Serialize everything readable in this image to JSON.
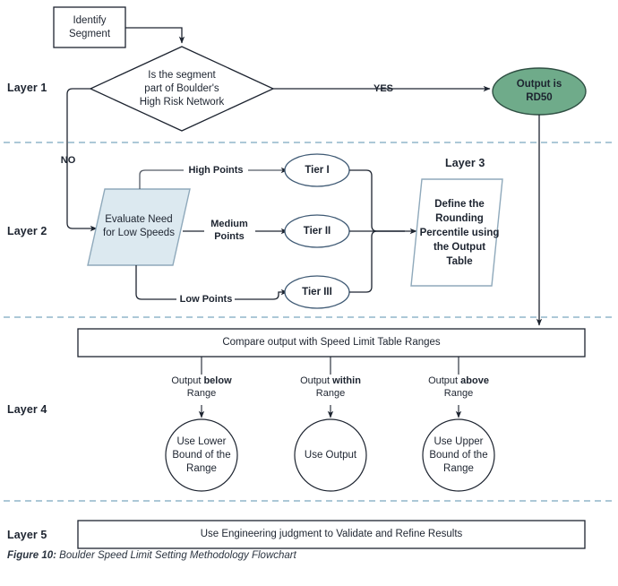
{
  "figure": {
    "caption_lead": "Figure 10:",
    "caption_text": " Boulder Speed Limit Setting Methodology Flowchart"
  },
  "colors": {
    "green_fill": "#6fab8a",
    "green_stroke": "#2f4f43",
    "blue_fill": "#dce9f0",
    "blue_stroke": "#8fa9bb",
    "line": "#1d2430",
    "divider": "#7ba7bf",
    "text": "#1d2430"
  },
  "layers": [
    {
      "id": "layer-1",
      "label": "Layer 1"
    },
    {
      "id": "layer-2",
      "label": "Layer 2"
    },
    {
      "id": "layer-3",
      "label": "Layer 3"
    },
    {
      "id": "layer-4",
      "label": "Layer 4"
    },
    {
      "id": "layer-5",
      "label": "Layer 5"
    }
  ],
  "nodes": {
    "identify_segment": "Identify\nSegment",
    "decision": "Is the segment\npart of Boulder's\nHigh Risk Network",
    "output_rd50": "Output is\nRD50",
    "evaluate": "Evaluate Need\nfor Low Speeds",
    "tier_1": "Tier I",
    "tier_2": "Tier II",
    "tier_3": "Tier III",
    "define_rounding": "Define the\nRounding\nPercentile using\nthe Output\nTable",
    "compare_bar": "Compare output with Speed Limit Table Ranges",
    "use_lower": "Use Lower\nBound of the\nRange",
    "use_output": "Use Output",
    "use_upper": "Use Upper\nBound of the\nRange",
    "engineering_bar": "Use Engineering judgment to Validate and Refine Results"
  },
  "edges": {
    "yes": "YES",
    "no": "NO",
    "high_points": "High Points",
    "medium_points": "Medium\nPoints",
    "low_points": "Low Points",
    "below_pre": "Output ",
    "below_bold": "below",
    "below_post": "\nRange",
    "within_pre": "Output ",
    "within_bold": "within",
    "within_post": "\nRange",
    "above_pre": "Output ",
    "above_bold": "above",
    "above_post": "\nRange"
  }
}
